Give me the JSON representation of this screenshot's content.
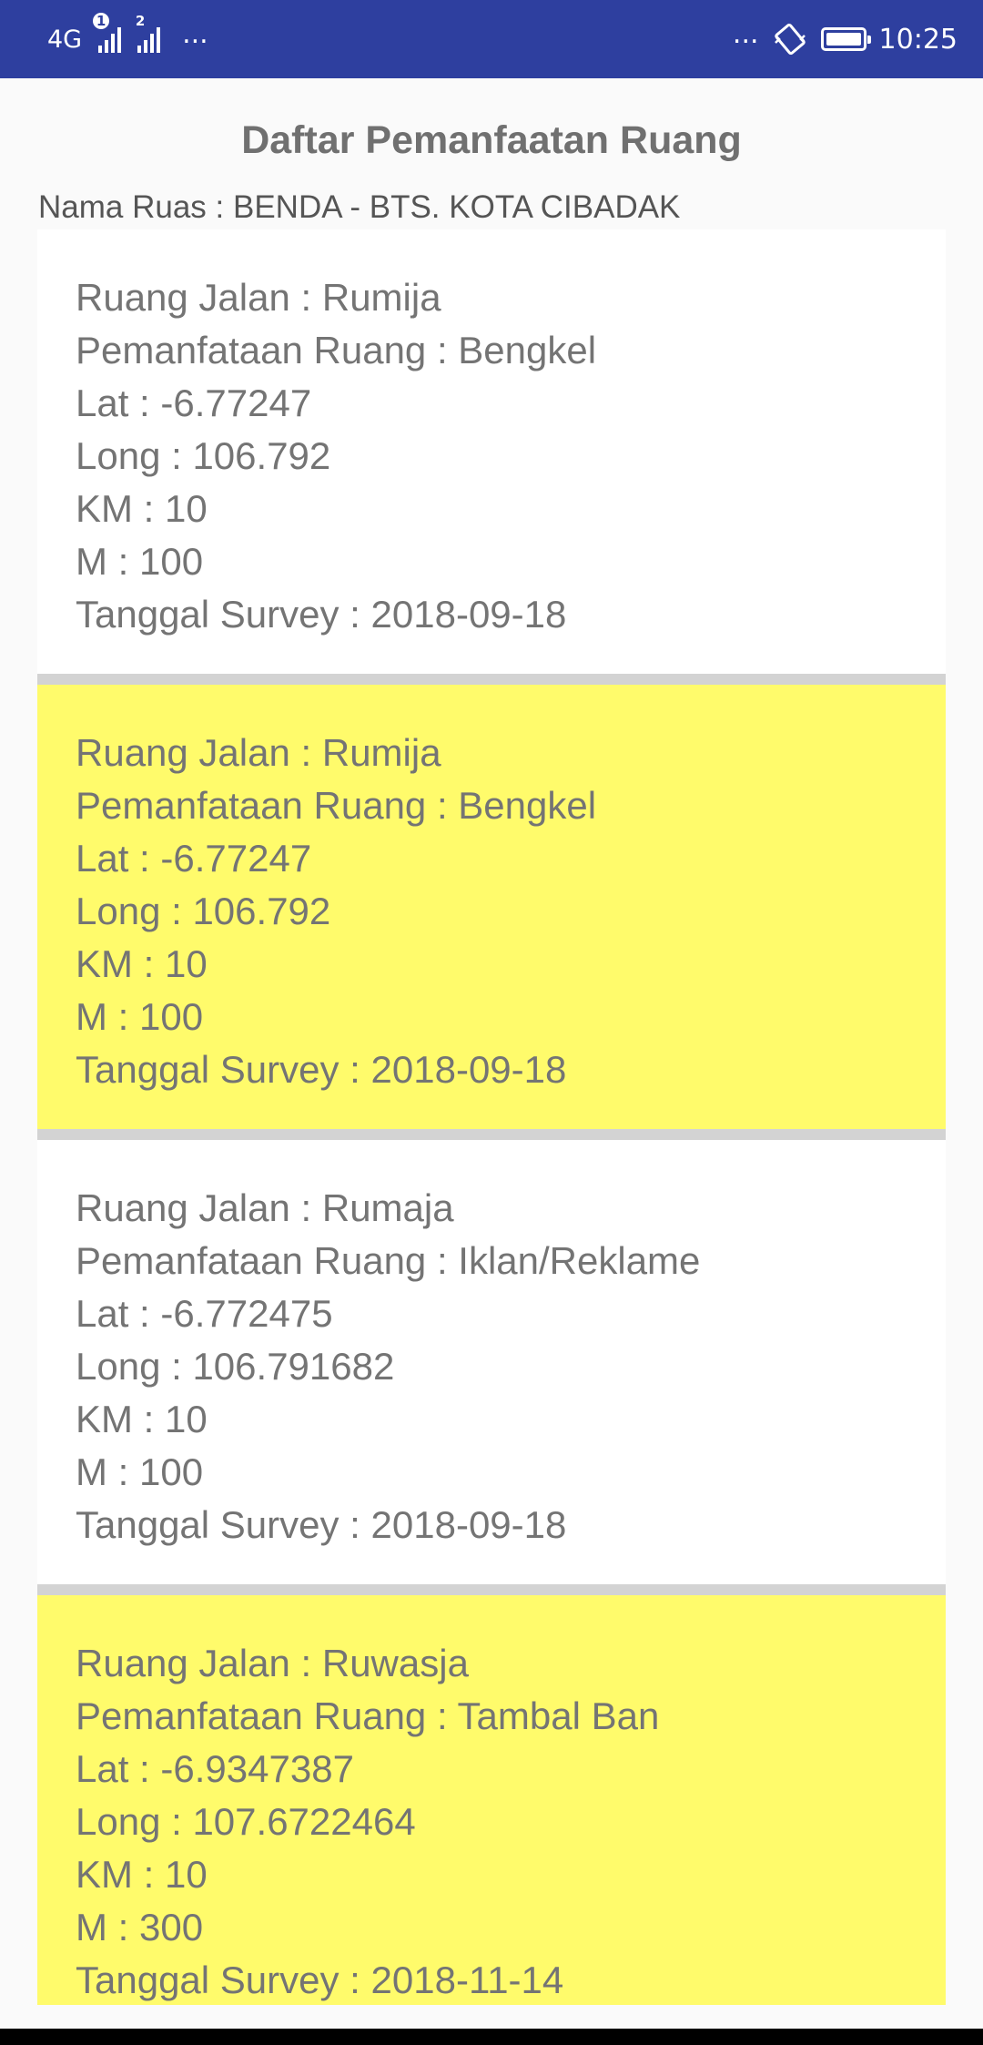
{
  "status_bar": {
    "network": "4G",
    "sim1_index": "1",
    "sim2_index": "2",
    "left_more": "...",
    "right_more": "...",
    "time": "10:25",
    "icons": [
      "signal-icon",
      "vibrate-icon",
      "battery-icon"
    ]
  },
  "header": {
    "title": "Daftar Pemanfaatan Ruang",
    "ruas_label": "Nama Ruas",
    "ruas_sep": " : ",
    "ruas_value": "BENDA - BTS. KOTA CIBADAK"
  },
  "labels": {
    "ruang_jalan": "Ruang Jalan",
    "pemanfaatan": "Pemanfataan Ruang",
    "pemanfaatan_alt": "Pemanfataan Ruang",
    "lat": "Lat",
    "long": "Long",
    "km": "KM",
    "m": "M",
    "tanggal": "Tanggal Survey",
    "sep": " : "
  },
  "items": [
    {
      "ruang_jalan_label": "Ruang Jalan",
      "ruang_jalan": "Rumija",
      "pemanfaatan_label": "Pemanfataan Ruang",
      "pemanfaatan": "Bengkel",
      "lat": "-6.77247",
      "long": "106.792",
      "km": "10",
      "m": "100",
      "tanggal": "2018-09-18",
      "highlight": false
    },
    {
      "ruang_jalan_label": "Ruang Jalan",
      "ruang_jalan": "Rumija",
      "pemanfaatan_label": "Pemanfataan Ruang",
      "pemanfaatan": "Bengkel",
      "lat": "-6.77247",
      "long": "106.792",
      "km": "10",
      "m": "100",
      "tanggal": "2018-09-18",
      "highlight": true
    },
    {
      "ruang_jalan_label": "Ruang Jalan",
      "ruang_jalan": "Rumaja",
      "pemanfaatan_label": "Pemanfataan Ruang",
      "pemanfaatan": "Iklan/Reklame",
      "lat": "-6.772475",
      "long": "106.791682",
      "km": "10",
      "m": "100",
      "tanggal": "2018-09-18",
      "highlight": false
    },
    {
      "ruang_jalan_label": "Ruang Jalan",
      "ruang_jalan": "Ruwasja",
      "pemanfaatan_label": "Pemanfataan Ruang",
      "pemanfaatan": "Tambal Ban",
      "lat": "-6.9347387",
      "long": "107.6722464",
      "km": "10",
      "m": "300",
      "tanggal": "2018-11-14",
      "highlight": true
    }
  ],
  "colors": {
    "status_bar": "#2e3f9f",
    "card_white": "#ffffff",
    "card_yellow": "#fffb6b",
    "divider": "#d3d3d3",
    "text": "#747474"
  }
}
